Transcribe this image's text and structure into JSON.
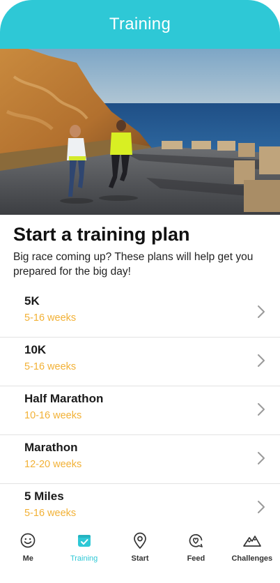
{
  "header": {
    "title": "Training"
  },
  "intro": {
    "title": "Start a training plan",
    "text": "Big race coming up? These plans will help get you prepared for the big day!"
  },
  "plans": [
    {
      "name": "5K",
      "weeks": "5-16 weeks"
    },
    {
      "name": "10K",
      "weeks": "5-16 weeks"
    },
    {
      "name": "Half Marathon",
      "weeks": "10-16 weeks"
    },
    {
      "name": "Marathon",
      "weeks": "12-20 weeks"
    },
    {
      "name": "5 Miles",
      "weeks": "5-16 weeks"
    }
  ],
  "tabs": [
    {
      "label": "Me",
      "icon": "smiley-icon"
    },
    {
      "label": "Training",
      "icon": "calendar-check-icon",
      "active": true
    },
    {
      "label": "Start",
      "icon": "map-pin-icon"
    },
    {
      "label": "Feed",
      "icon": "heart-chat-icon"
    },
    {
      "label": "Challenges",
      "icon": "mountain-icon"
    }
  ],
  "colors": {
    "accent": "#2ec8d6",
    "weeks": "#f2b136"
  }
}
